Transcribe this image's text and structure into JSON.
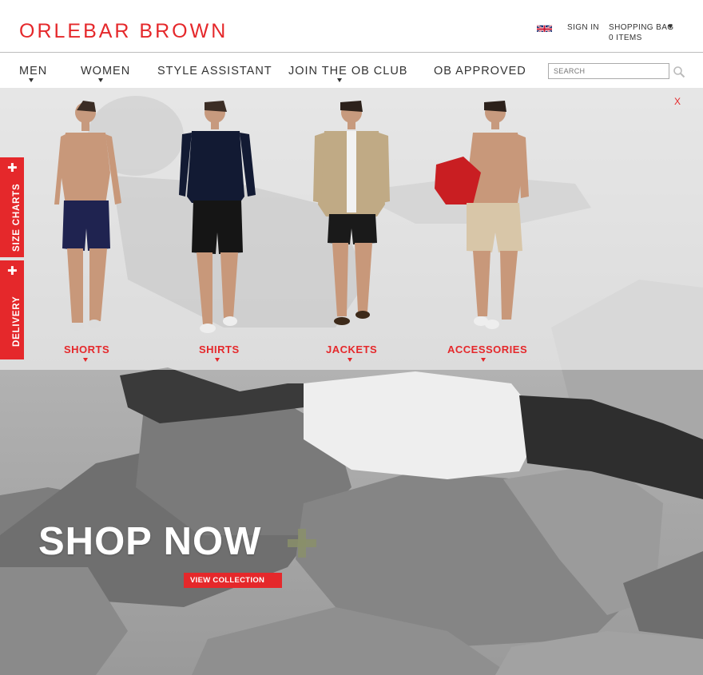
{
  "brand": {
    "logo_text": "ORLEBAR BROWN",
    "accent": "#e5282b"
  },
  "header": {
    "flag_icon": "uk-flag-icon",
    "sign_in": "SIGN IN",
    "shopping_bag": "SHOPPING BAG",
    "bag_items": "0 ITEMS"
  },
  "nav": {
    "items": [
      {
        "label": "MEN",
        "has_dropdown": true
      },
      {
        "label": "WOMEN",
        "has_dropdown": true
      },
      {
        "label": "STYLE ASSISTANT",
        "has_dropdown": false
      },
      {
        "label": "JOIN THE OB CLUB",
        "has_dropdown": true
      },
      {
        "label": "OB APPROVED",
        "has_dropdown": false
      }
    ],
    "search_placeholder": "SEARCH",
    "search_icon": "magnifier-icon"
  },
  "promo_panel": {
    "close": "X",
    "categories": [
      "SHORTS",
      "SHIRTS",
      "JACKETS",
      "ACCESSORIES"
    ]
  },
  "side_tabs": [
    {
      "label": "SIZE CHARTS",
      "icon": "plus-icon"
    },
    {
      "label": "DELIVERY",
      "icon": "plus-icon"
    }
  ],
  "hero": {
    "headline": "SHOP NOW",
    "headline_icon": "plus-icon",
    "cta": "VIEW COLLECTION"
  }
}
